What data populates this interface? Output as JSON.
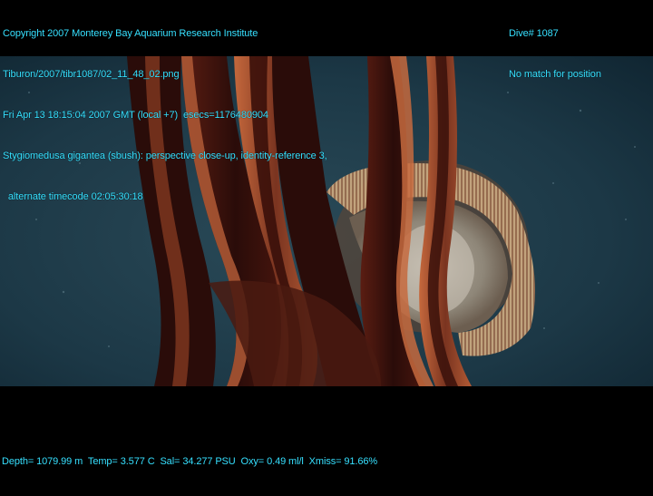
{
  "header_left": {
    "line1": "Copyright 2007 Monterey Bay Aquarium Research Institute",
    "line2": "Tiburon/2007/tibr1087/02_11_48_02.png",
    "line3": "Fri Apr 13 18:15:04 2007 GMT (local +7)  esecs=1176480904",
    "line4": "Stygiomedusa gigantea (sbush): perspective close-up, identity-reference 3,",
    "line5": "  alternate timecode 02:05:30:18"
  },
  "header_right": {
    "line1": "Dive# 1087",
    "line2": "No match for position"
  },
  "footer": {
    "telemetry": "Depth= 1079.99 m  Temp= 3.577 C  Sal= 34.277 PSU  Oxy= 0.49 ml/l  Xmiss= 91.66%"
  },
  "colors": {
    "overlay_text": "#36e0ff",
    "water": "#1c3846",
    "letterbox": "#000000",
    "arm_dark": "#2a0c09",
    "arm_edge": "#c5683c",
    "bell_rim": "#c8a880"
  },
  "image_subject": "deep-sea jellyfish"
}
